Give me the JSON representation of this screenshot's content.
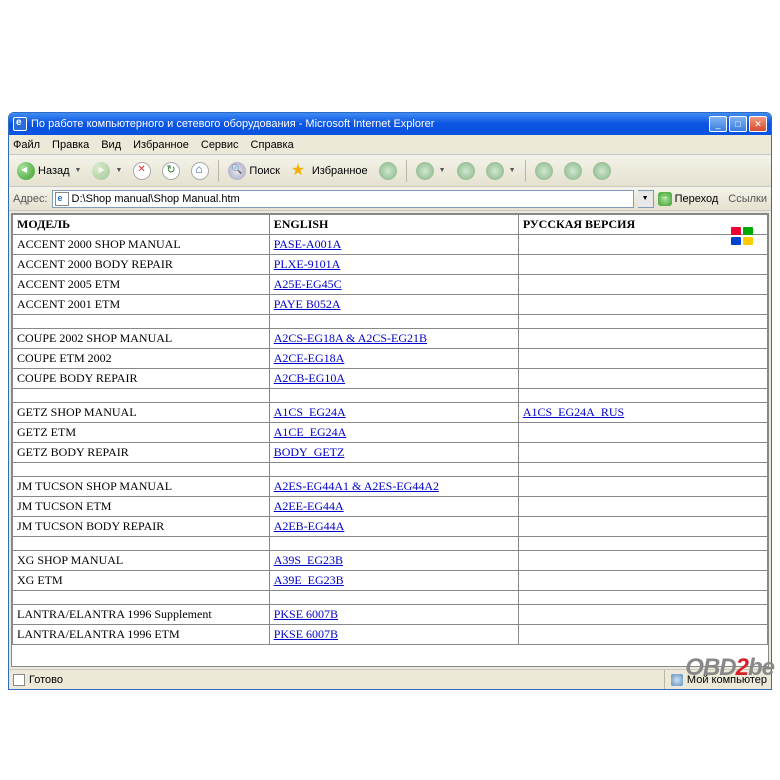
{
  "window": {
    "title": "По работе компьютерного и сетевого оборудования - Microsoft Internet Explorer"
  },
  "menu": {
    "file": "Файл",
    "edit": "Правка",
    "view": "Вид",
    "favorites": "Избранное",
    "tools": "Сервис",
    "help": "Справка"
  },
  "toolbar": {
    "back": "Назад",
    "search": "Поиск",
    "favorites": "Избранное"
  },
  "addressbar": {
    "label": "Адрес:",
    "value": "D:\\Shop manual\\Shop Manual.htm",
    "go": "Переход",
    "links": "Ссылки"
  },
  "table": {
    "headers": {
      "model": "МОДЕЛЬ",
      "english": "ENGLISH",
      "russian": "РУССКАЯ ВЕРСИЯ"
    },
    "groups": [
      {
        "rows": [
          {
            "model": "ACCENT 2000 SHOP MANUAL",
            "english": "PASE-A001A",
            "russian": ""
          },
          {
            "model": "ACCENT 2000 BODY REPAIR",
            "english": "PLXE-9101A",
            "russian": ""
          },
          {
            "model": "ACCENT 2005 ETM",
            "english": "A25E-EG45C",
            "russian": ""
          },
          {
            "model": "ACCENT 2001 ETM",
            "english": "PAYE B052A",
            "russian": ""
          }
        ]
      },
      {
        "rows": [
          {
            "model": "COUPE 2002 SHOP MANUAL",
            "english": "A2CS-EG18A & A2CS-EG21B",
            "russian": ""
          },
          {
            "model": "COUPE ETM 2002",
            "english": "A2CE-EG18A",
            "russian": ""
          },
          {
            "model": "COUPE BODY REPAIR",
            "english": "A2CB-EG10A",
            "russian": ""
          }
        ]
      },
      {
        "rows": [
          {
            "model": "GETZ SHOP MANUAL",
            "english": "A1CS_EG24A",
            "russian": "A1CS_EG24A_RUS"
          },
          {
            "model": "GETZ ETM",
            "english": "A1CE_EG24A",
            "russian": ""
          },
          {
            "model": "GETZ BODY REPAIR",
            "english": "BODY_GETZ",
            "russian": ""
          }
        ]
      },
      {
        "rows": [
          {
            "model": "JM TUCSON SHOP MANUAL",
            "english": "A2ES-EG44A1 & A2ES-EG44A2",
            "russian": ""
          },
          {
            "model": "JM TUCSON ETM",
            "english": "A2EE-EG44A",
            "russian": ""
          },
          {
            "model": "JM TUCSON BODY REPAIR",
            "english": "A2EB-EG44A",
            "russian": ""
          }
        ]
      },
      {
        "rows": [
          {
            "model": "XG SHOP MANUAL",
            "english": "A39S_EG23B",
            "russian": ""
          },
          {
            "model": "XG ETM",
            "english": "A39E_EG23B",
            "russian": ""
          }
        ]
      },
      {
        "rows": [
          {
            "model": "LANTRA/ELANTRA 1996 Supplement",
            "english": "PKSE 6007B",
            "russian": ""
          },
          {
            "model": "LANTRA/ELANTRA 1996 ETM",
            "english": "PKSE 6007B",
            "russian": ""
          }
        ]
      }
    ]
  },
  "statusbar": {
    "status": "Готово",
    "zone": "Мой компьютер"
  },
  "watermark": {
    "part1": "OBD",
    "part2": "2",
    "part3": "be"
  }
}
